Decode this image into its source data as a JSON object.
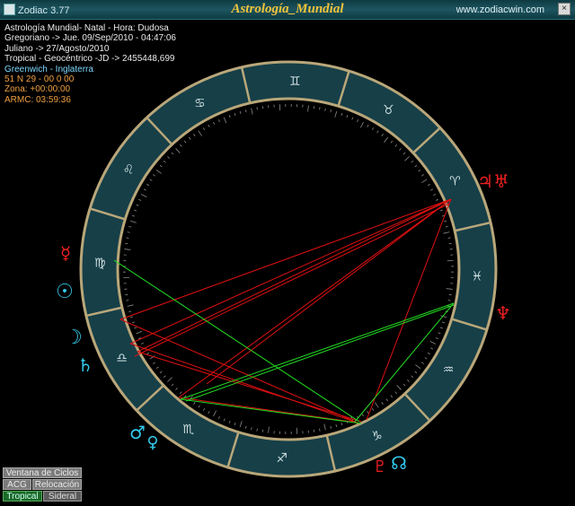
{
  "window": {
    "app_name": "Zodiac 3.77",
    "title": "Astrología_Mundial",
    "website": "www.zodiacwin.com",
    "close_symbol": "×"
  },
  "info_lines": [
    "Astrología Mundial- Natal - Hora: Dudosa",
    "Gregoriano -> Jue. 09/Sep/2010 - 04:47:06",
    "Juliano -> 27/Agosto/2010",
    "Tropical - Geocéntrico -JD -> 2455448,699",
    "Greenwich - Inglaterra",
    "51 N 29 - 00 0 00",
    "Zona: +00:00:00",
    "ARMC: 03:59:36"
  ],
  "buttons": {
    "ventana": "Ventana de Ciclos",
    "acg": "ACG",
    "relocacion": "Relocación",
    "tropical": "Tropical",
    "sideral": "Sideral"
  },
  "colors": {
    "wheel_fill": "#163f48",
    "wheel_border": "#b9a77a",
    "glyph": "#cfdfe0",
    "aspect_red": "#e01010",
    "aspect_green": "#22dd22",
    "planet_red": "#ee2020",
    "planet_cyan": "#33ccee"
  },
  "zodiac_signs": [
    {
      "name": "aries",
      "glyph": "♈"
    },
    {
      "name": "taurus",
      "glyph": "♉"
    },
    {
      "name": "gemini",
      "glyph": "♊"
    },
    {
      "name": "cancer",
      "glyph": "♋"
    },
    {
      "name": "leo",
      "glyph": "♌"
    },
    {
      "name": "virgo",
      "glyph": "♍"
    },
    {
      "name": "libra",
      "glyph": "♎"
    },
    {
      "name": "scorpio",
      "glyph": "♏"
    },
    {
      "name": "sagittarius",
      "glyph": "♐"
    },
    {
      "name": "capricorn",
      "glyph": "♑"
    },
    {
      "name": "aquarius",
      "glyph": "♒"
    },
    {
      "name": "pisces",
      "glyph": "♓"
    }
  ],
  "planets": [
    {
      "name": "jupiter-uranus",
      "glyph": "♃♅",
      "color": "red"
    },
    {
      "name": "neptune",
      "glyph": "♆",
      "color": "red"
    },
    {
      "name": "mercury",
      "glyph": "☿",
      "color": "red"
    },
    {
      "name": "sun",
      "glyph": "☉",
      "color": "cyan"
    },
    {
      "name": "moon",
      "glyph": "☽",
      "color": "cyan"
    },
    {
      "name": "saturn",
      "glyph": "♄",
      "color": "cyan"
    },
    {
      "name": "mars",
      "glyph": "♂",
      "color": "cyan"
    },
    {
      "name": "venus",
      "glyph": "♀",
      "color": "cyan"
    },
    {
      "name": "pluto",
      "glyph": "♇",
      "color": "red"
    },
    {
      "name": "node",
      "glyph": "☊",
      "color": "cyan"
    }
  ]
}
